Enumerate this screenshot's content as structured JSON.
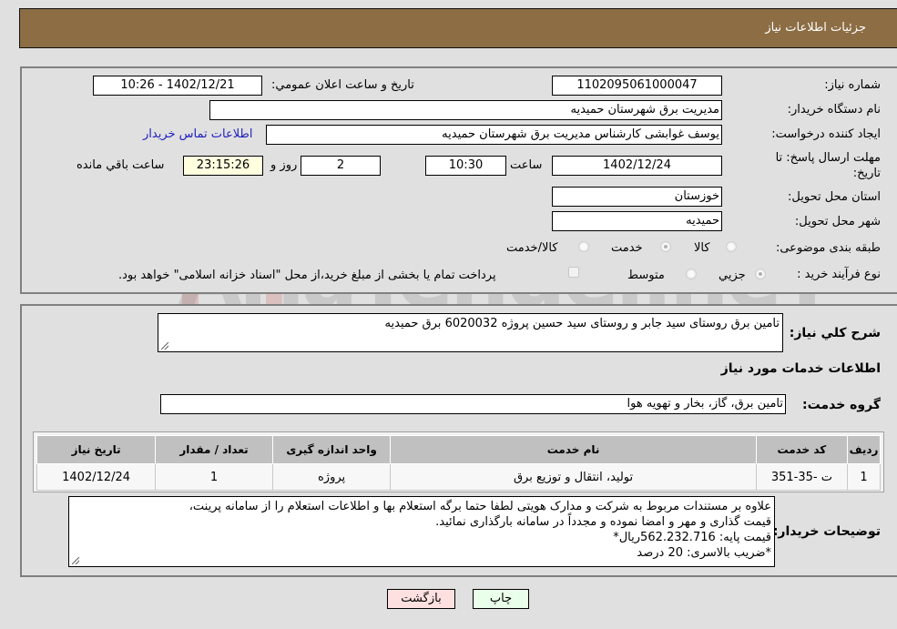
{
  "header": {
    "title": "جزئيات اطلاعات نياز"
  },
  "form": {
    "need_number": {
      "label": "شماره نياز:",
      "value": "1102095061000047"
    },
    "announce_datetime": {
      "label": "تاريخ و ساعت اعلان عمومي:",
      "value": "1402/12/21 - 10:26"
    },
    "buyer_org": {
      "label": "نام دستگاه خريدار:",
      "value": "مديريت برق شهرستان حميديه"
    },
    "requester": {
      "label": "ايجاد کننده درخواست:",
      "value": "يوسف غوابشی کارشناس مديريت برق شهرستان حميديه"
    },
    "buyer_contact_link": "اطلاعات تماس خريدار",
    "deadline": {
      "label": "مهلت ارسال پاسخ: تا تاريخ:",
      "date": "1402/12/24",
      "time_label": "ساعت",
      "time": "10:30",
      "days": "2",
      "days_label": "روز و",
      "remaining": "23:15:26",
      "remaining_label": "ساعت باقي مانده"
    },
    "province": {
      "label": "استان محل تحويل:",
      "value": "خوزستان"
    },
    "city": {
      "label": "شهر محل تحويل:",
      "value": "حميديه"
    },
    "category": {
      "label": "طبقه بندی موضوعی:",
      "options": [
        "کالا",
        "خدمت",
        "کالا/خدمت"
      ],
      "selected": "خدمت"
    },
    "purchase_type": {
      "label": "نوع فرآيند خريد :",
      "options": [
        "جزيي",
        "متوسط"
      ],
      "selected": "جزيي",
      "treasury_note": "پرداخت تمام يا بخشی از مبلغ خريد،از محل \"اسناد خزانه اسلامی\" خواهد بود."
    }
  },
  "details": {
    "summary_label": "شرح کلي نياز:",
    "summary": "تامين برق روستای سيد جابر و روستای سيد حسين پروژه 6020032 برق حميديه",
    "services_heading": "اطلاعات خدمات مورد نياز",
    "service_group_label": "گروه خدمت:",
    "service_group": "تامين برق، گاز، بخار و تهويه هوا",
    "table": {
      "headers": [
        "رديف",
        "کد خدمت",
        "نام خدمت",
        "واحد اندازه گيری",
        "تعداد / مقدار",
        "تاريخ نياز"
      ],
      "rows": [
        [
          "1",
          "ت -35-351",
          "توليد، انتقال و توزيع برق",
          "پروژه",
          "1",
          "1402/12/24"
        ]
      ]
    },
    "buyer_notes_label": "توضيحات خريدار:",
    "buyer_notes": [
      "علاوه بر مستندات مربوط به شرکت و مدارک هويتی لطفا حتما برگه استعلام بها و اطلاعات استعلام را از سامانه پرينت،",
      "قيمت گذاری و مهر و امضا نموده و مجدداً در سامانه بارگذاری نمائيد.",
      " قيمت پايه: 562.232.716ريال*",
      "*ضريب بالاسری:  20 درصد"
    ]
  },
  "buttons": {
    "print": "چاپ",
    "back": "بازگشت"
  },
  "colors": {
    "header_bg": "#8c6d44",
    "print_bg": "#eaffea",
    "back_bg": "#ffe0e0",
    "link": "#2020c0"
  },
  "watermark": "AriaTender.neT"
}
